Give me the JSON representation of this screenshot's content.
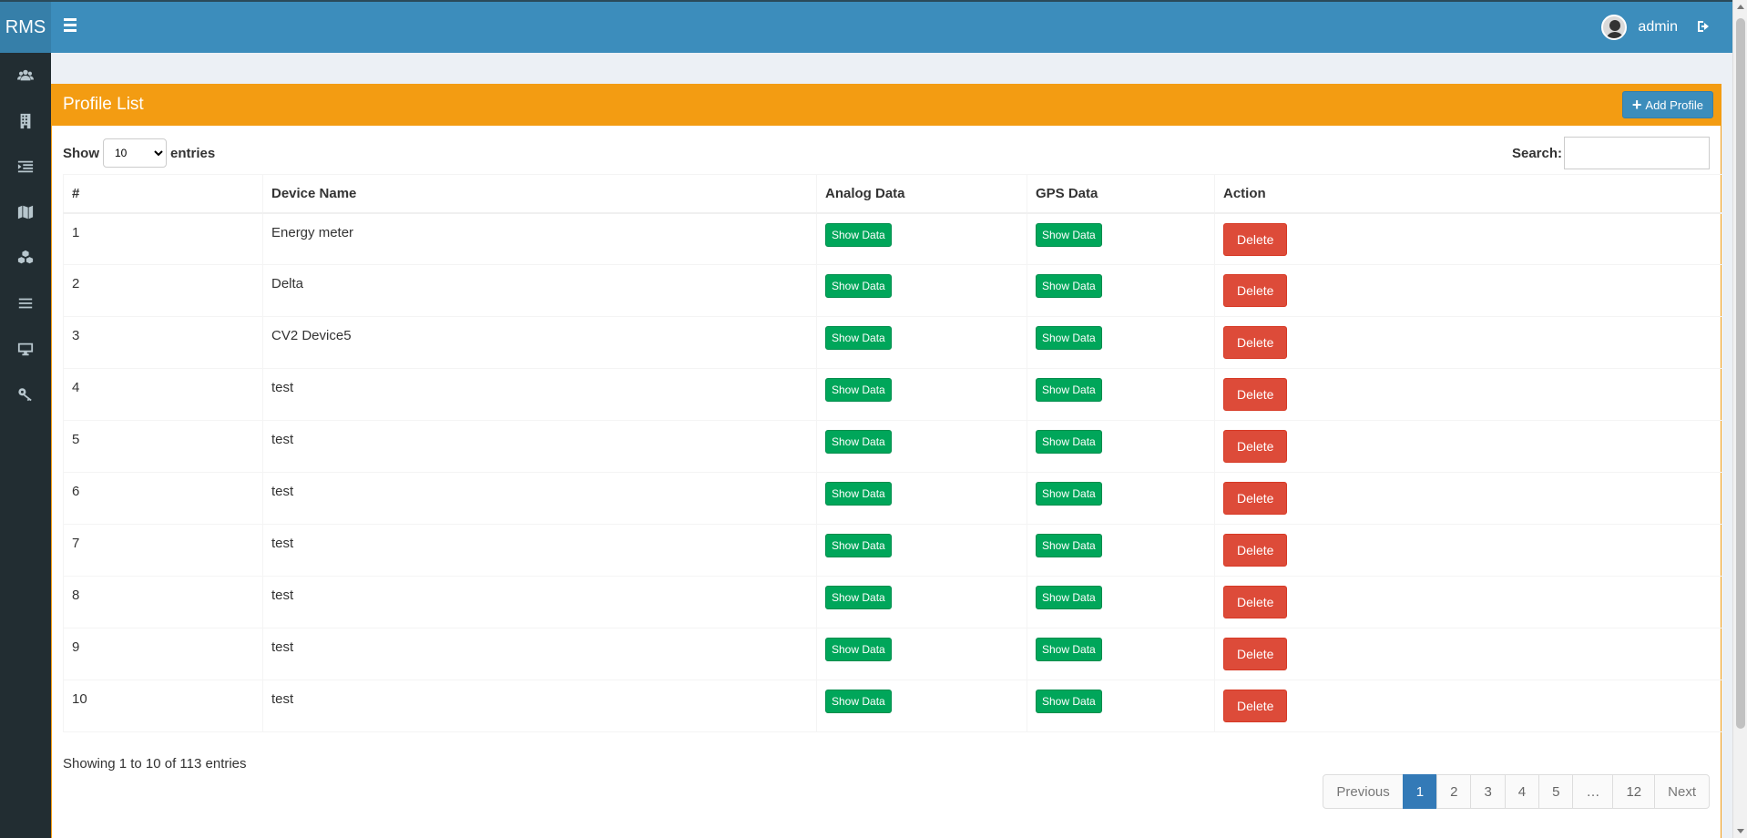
{
  "app": {
    "logo": "RMS",
    "user_name": "admin"
  },
  "sidebar": {
    "items": [
      {
        "icon": "users-icon"
      },
      {
        "icon": "building-icon"
      },
      {
        "icon": "indent-list-icon"
      },
      {
        "icon": "map-icon"
      },
      {
        "icon": "cubes-icon"
      },
      {
        "icon": "bars-icon"
      },
      {
        "icon": "desktop-icon"
      },
      {
        "icon": "key-icon"
      }
    ]
  },
  "box": {
    "title": "Profile List",
    "add_label": "Add Profile"
  },
  "controls": {
    "show_label": "Show",
    "entries_value": "10",
    "entries_label": "entries",
    "search_label": "Search:"
  },
  "table": {
    "headers": [
      "#",
      "Device Name",
      "Analog Data",
      "GPS Data",
      "Action"
    ],
    "show_label": "Show Data",
    "delete_label": "Delete",
    "rows": [
      {
        "num": "1",
        "name": "Energy meter"
      },
      {
        "num": "2",
        "name": "Delta"
      },
      {
        "num": "3",
        "name": "CV2 Device5"
      },
      {
        "num": "4",
        "name": "test"
      },
      {
        "num": "5",
        "name": "test"
      },
      {
        "num": "6",
        "name": "test"
      },
      {
        "num": "7",
        "name": "test"
      },
      {
        "num": "8",
        "name": "test"
      },
      {
        "num": "9",
        "name": "test"
      },
      {
        "num": "10",
        "name": "test"
      }
    ]
  },
  "footer": {
    "info": "Showing 1 to 10 of 113 entries",
    "pages": [
      "Previous",
      "1",
      "2",
      "3",
      "4",
      "5",
      "…",
      "12",
      "Next"
    ]
  },
  "colors": {
    "header": "#3c8dbc",
    "sidebar": "#222d32",
    "box": "#f39c12",
    "success": "#00a65a",
    "danger": "#dd4b39"
  }
}
